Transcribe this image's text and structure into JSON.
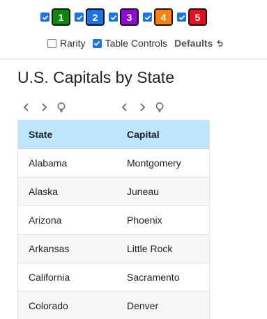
{
  "rarity_filters": [
    {
      "label": "1",
      "checked": true,
      "color": "#0a8a0a"
    },
    {
      "label": "2",
      "checked": true,
      "color": "#1a73e8"
    },
    {
      "label": "3",
      "checked": true,
      "color": "#8e0ad6"
    },
    {
      "label": "4",
      "checked": true,
      "color": "#ff7f0e"
    },
    {
      "label": "5",
      "checked": true,
      "color": "#e8101e"
    }
  ],
  "controls": {
    "rarity_label": "Rarity",
    "rarity_checked": false,
    "table_controls_label": "Table Controls",
    "table_controls_checked": true,
    "defaults_label": "Defaults"
  },
  "page_title": "U.S. Capitals by State",
  "table": {
    "headers": [
      "State",
      "Capital"
    ],
    "rows": [
      [
        "Alabama",
        "Montgomery"
      ],
      [
        "Alaska",
        "Juneau"
      ],
      [
        "Arizona",
        "Phoenix"
      ],
      [
        "Arkansas",
        "Little Rock"
      ],
      [
        "California",
        "Sacramento"
      ],
      [
        "Colorado",
        "Denver"
      ]
    ]
  },
  "icons": {
    "prev": "chevron-left-icon",
    "next": "chevron-right-icon",
    "hint": "lightbulb-icon",
    "undo": "undo-icon"
  }
}
